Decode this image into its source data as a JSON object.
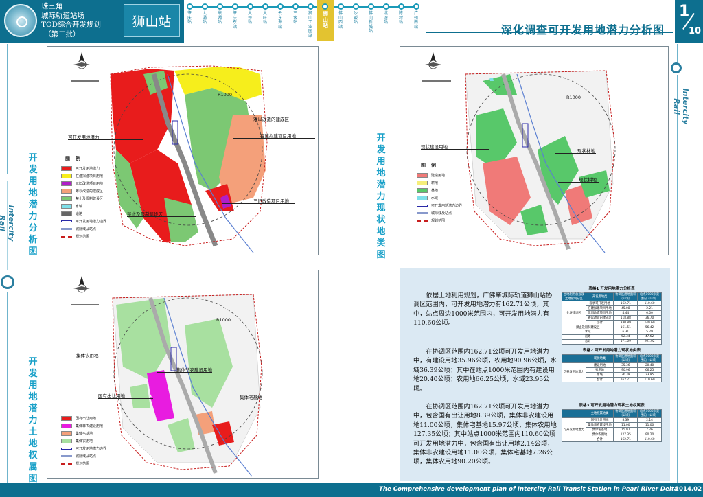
{
  "header": {
    "brand_lines": [
      "珠三角",
      "城际轨道站场",
      "TOD综合开发规划",
      "（第二批）"
    ],
    "station": "狮山站",
    "stations": [
      "肇庆站",
      "大涌站",
      "鼎湖站",
      "肇庆东站",
      "大沙站",
      "大旺站",
      "云东海站",
      "三水站",
      "狮山工业园站",
      "狮山站",
      "佛山西站",
      "沙畈站",
      "佛山新城站",
      "北滘站",
      "陈村站",
      "广州南站"
    ],
    "current_station_index": 9,
    "title": "深化调查可开发用地潜力分析图",
    "page_num": "1",
    "page_den": "10"
  },
  "rail_label": "Intercity Rail",
  "section_labels": {
    "potential": "开发用地潜力分析图",
    "current": "开发用地潜力现状地类图",
    "ownership": "开发用地潜力土地权属图"
  },
  "maps": {
    "potential": {
      "r_label": "R1000",
      "legend_title": "图例",
      "legend": [
        {
          "label": "可开发用地潜力",
          "color": "#e81c1c"
        },
        {
          "label": "在建拟建项目用地",
          "color": "#f6ee1c"
        },
        {
          "label": "三旧改造项目用地",
          "color": "#b01ec8"
        },
        {
          "label": "难以改造的建成区",
          "color": "#f4a07a"
        },
        {
          "label": "禁止及限制建设区",
          "color": "#7cc873"
        },
        {
          "label": "水域",
          "color": "#7fe0ea"
        },
        {
          "label": "道路",
          "color": "#666666"
        },
        {
          "label": "可开发用地潜力边界",
          "color": "#2a2aa8"
        },
        {
          "label": "城际线及站点",
          "color": "#8899cc"
        },
        {
          "label": "规划范围",
          "color": "#c81e1e"
        }
      ],
      "callouts": [
        "可开发用地潜力",
        "难以改造的建成区",
        "在建拟建项目用地",
        "三旧改造项目用地",
        "禁止及限制建设区"
      ]
    },
    "current": {
      "r_label": "R1000",
      "legend_title": "图例",
      "legend": [
        {
          "label": "建设用地",
          "color": "#f07a78"
        },
        {
          "label": "耕地",
          "color": "#f6ee7a"
        },
        {
          "label": "林地",
          "color": "#58c86a"
        },
        {
          "label": "水域",
          "color": "#7fe0ea"
        },
        {
          "label": "可开发用地潜力边界",
          "color": "#2a2aa8"
        },
        {
          "label": "城际线及站点",
          "color": "#8899cc"
        },
        {
          "label": "规划范围",
          "color": "#c81e1e"
        }
      ],
      "callouts": [
        "现状建设用地",
        "现状林地",
        "现状耕地"
      ]
    },
    "ownership": {
      "r_label": "R1000",
      "legend": [
        {
          "label": "国有出让用地",
          "color": "#e81c1c"
        },
        {
          "label": "集体非农建设用地",
          "color": "#e81ce0"
        },
        {
          "label": "集体宅基地",
          "color": "#f4a07a"
        },
        {
          "label": "集体农用地",
          "color": "#a8e0a0"
        },
        {
          "label": "可开发用地潜力边界",
          "color": "#2a2aa8"
        },
        {
          "label": "城际线及站点",
          "color": "#8899cc"
        },
        {
          "label": "规划范围",
          "color": "#c81e1e"
        }
      ],
      "callouts": [
        "集体农用地",
        "集体非农建设用地",
        "国有出让用地",
        "集体宅基地"
      ]
    }
  },
  "paragraphs": [
    "依据土地利用规划，广佛肇城际轨道狮山站协调区范围内，可开发用地潜力有162.71公顷，其中，站点周边1000米范围内，可开发用地潜力有110.60公顷。",
    "在协调区范围内162.71公顷可开发用地潜力中，有建设用地35.96公顷，农用地90.96公顷，水域36.39公顷；其中在站点1000米范围内有建设用地20.40公顷；农用地66.25公顷，水域23.95公顷。",
    "在协调区范围内162.71公顷可开发用地潜力中，包含国有出让用地8.39公顷，集体非农建设用地11.00公顷，集体宅基地15.97公顷，集体农用地127.35公顷；其中站点1000米范围内110.60公顷可开发用地潜力中，包含国有出让用地2.14公顷，集体非农建设用地11.00公顷，集体宅基地7.26公顷，集体农用地90.20公顷。"
  ],
  "tables": [
    {
      "caption": "表格1 开发用地潜力分析表",
      "headers": [
        "土地利用总规及土地管制分区",
        "开发用地类",
        "协调区用地面积（公顷）",
        "站点1000米范围内（公顷）"
      ],
      "group": "允许建设区",
      "rows": [
        [
          "",
          "现状可开发用地",
          "162.71",
          "110.60"
        ],
        [
          "",
          "在建拟建项目用地",
          "45.08",
          "2.21"
        ],
        [
          "",
          "三旧改造项目用地",
          "4.44",
          "0.00"
        ],
        [
          "",
          "难以改造的建成区",
          "118.88",
          "36.70"
        ],
        [
          "",
          "小计",
          "330.89",
          "149.69"
        ],
        [
          "禁止及限制建设区",
          "",
          "161.51",
          "56.42"
        ],
        [
          "水域",
          "",
          "6.31",
          "5.29"
        ],
        [
          "道路",
          "",
          "52.34",
          "47.62"
        ],
        [
          "总计",
          "",
          "571.09",
          "261.02"
        ]
      ]
    },
    {
      "caption": "表格2 可开发用地潜力现状地类表",
      "headers": [
        "",
        "现状地类",
        "协调区用地面积（公顷）",
        "站点1000米范围内（公顷）"
      ],
      "group": "可开发用地潜力",
      "rows": [
        [
          "",
          "建设用地",
          "35.36",
          "20.40"
        ],
        [
          "",
          "农用地",
          "90.96",
          "66.25"
        ],
        [
          "",
          "水域",
          "36.39",
          "23.95"
        ],
        [
          "",
          "合计",
          "162.71",
          "110.60"
        ]
      ]
    },
    {
      "caption": "表格3 可开发用地潜力现状土地权属表",
      "headers": [
        "",
        "土地权属地类",
        "协调区用地面积（公顷）",
        "站点1000米范围内（公顷）"
      ],
      "group": "可开发用地潜力",
      "rows": [
        [
          "",
          "国有出让用地",
          "8.39",
          "2.14"
        ],
        [
          "",
          "集体非农建设用地",
          "11.00",
          "11.00"
        ],
        [
          "",
          "集体宅基地",
          "15.97",
          "7.26"
        ],
        [
          "",
          "集体农用地",
          "127.35",
          "90.20"
        ],
        [
          "",
          "合计",
          "162.71",
          "110.60"
        ]
      ]
    }
  ],
  "footer": {
    "text": "The Comprehensive development plan of Intercity Rail Transit Station in Pearl River Delta",
    "date": "2014.02"
  }
}
